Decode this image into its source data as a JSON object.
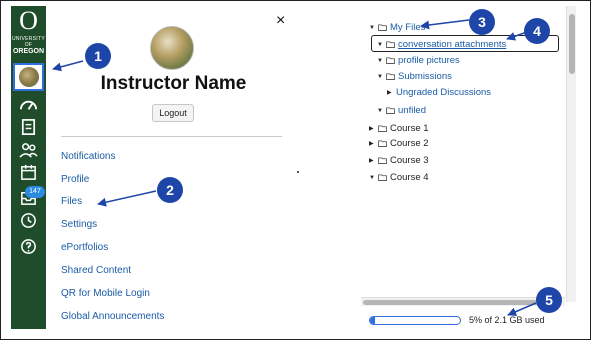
{
  "nav": {
    "logo_letter": "O",
    "logo_line1": "UNIVERSITY OF",
    "logo_line2": "OREGON",
    "icons": [
      "account-avatar-icon",
      "dashboard-icon",
      "courses-icon",
      "groups-icon",
      "calendar-icon",
      "inbox-icon",
      "history-icon",
      "help-icon"
    ],
    "inbox_badge": "147",
    "color_bg": "#1f4d2b"
  },
  "tray": {
    "close_label": "×",
    "name": "Instructor Name",
    "logout_label": "Logout",
    "links": [
      "Notifications",
      "Profile",
      "Files",
      "Settings",
      "ePortfolios",
      "Shared Content",
      "QR for Mobile Login",
      "Global Announcements"
    ]
  },
  "files": {
    "root": "My Files",
    "children": [
      "conversation attachments",
      "profile pictures",
      "Submissions",
      "unfiled"
    ],
    "submissions_child": "Ungraded Discussions",
    "courses": [
      "Course 1",
      "Course 2",
      "Course 3",
      "Course 4"
    ],
    "quota_text": "5% of 2.1 GB used",
    "quota_fraction": 0.05
  },
  "callouts": [
    "1",
    "2",
    "3",
    "4",
    "5"
  ],
  "colors": {
    "link": "#1a5ca6",
    "callout": "#1e46a8",
    "accent": "#2f6fdf"
  }
}
